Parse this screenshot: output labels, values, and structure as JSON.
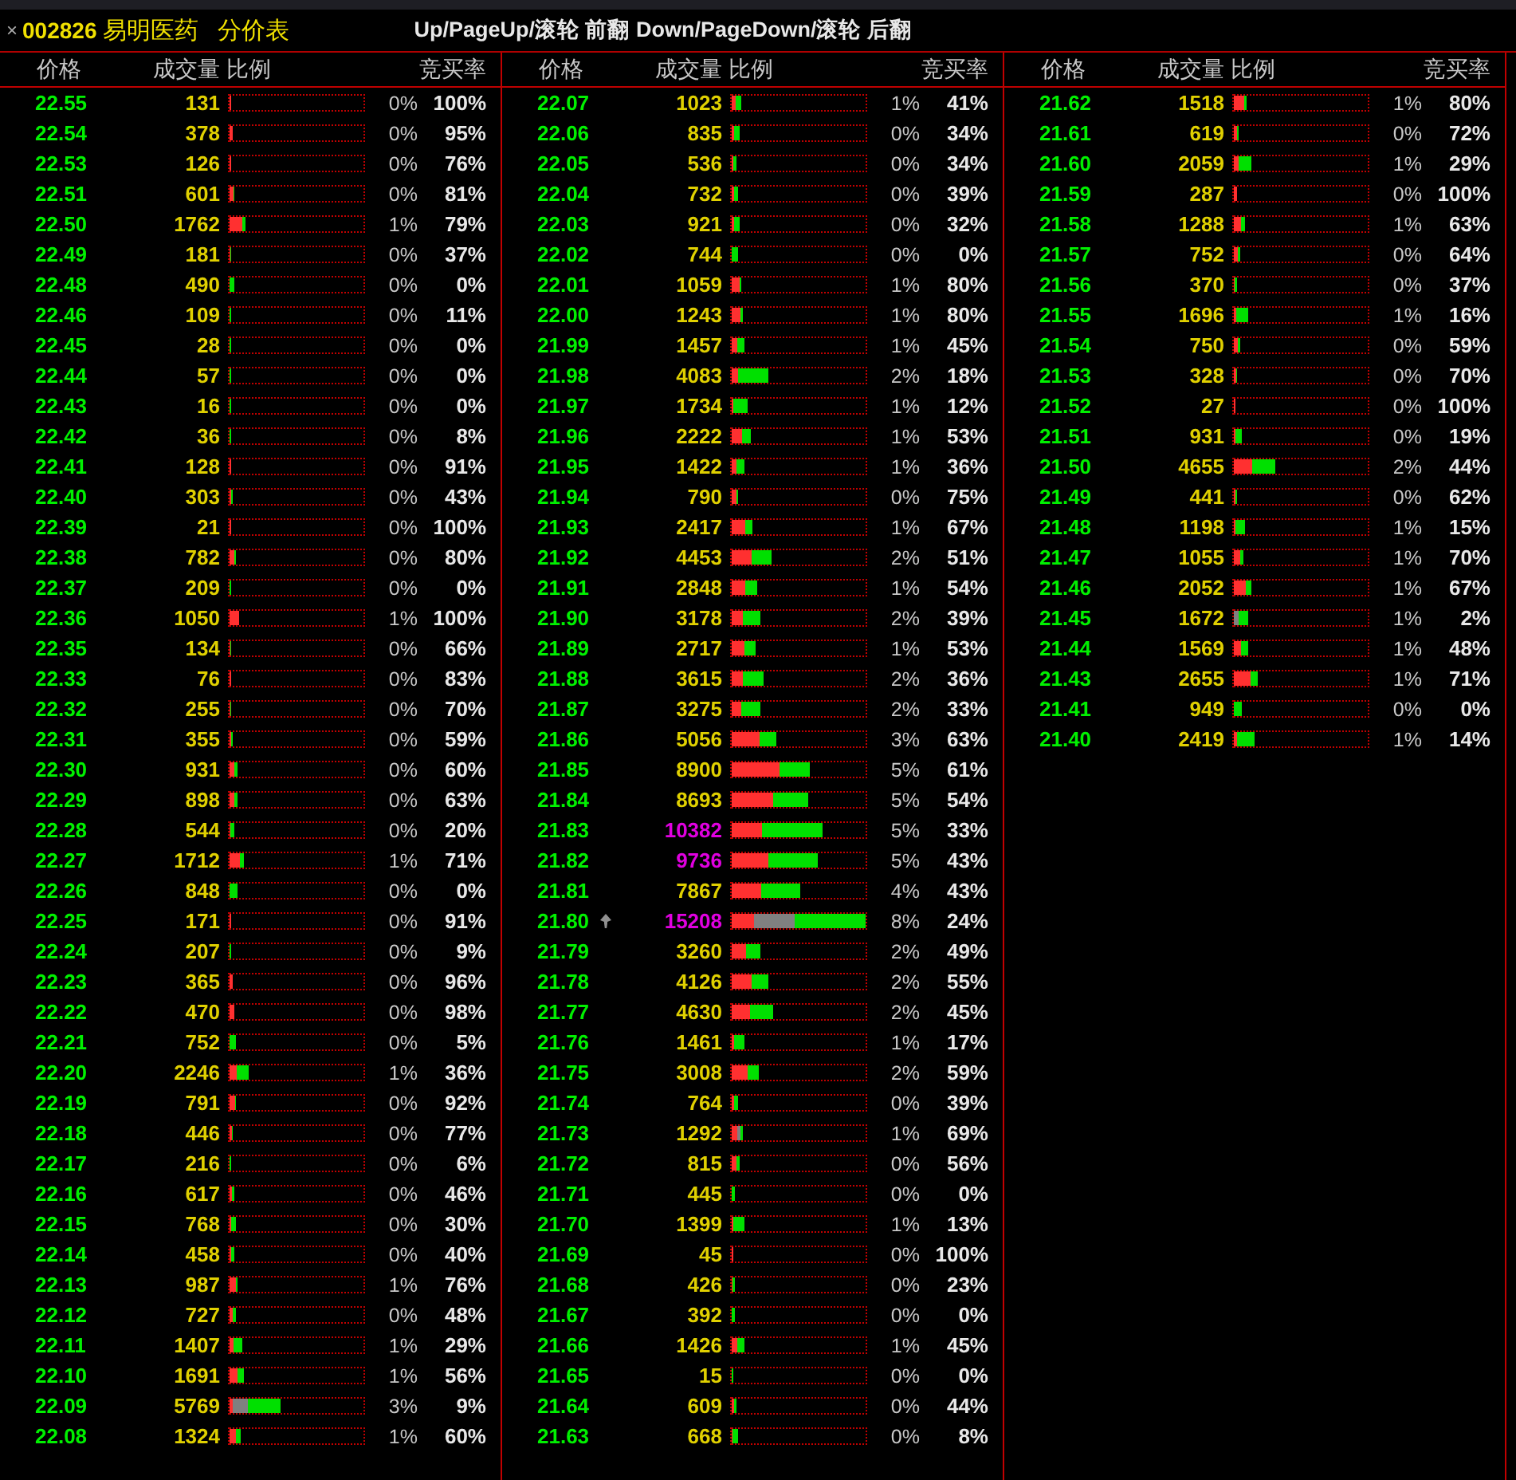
{
  "title": {
    "close": "×",
    "code": "002826",
    "name": "易明医药",
    "view": "分价表"
  },
  "hint": "Up/PageUp/滚轮 前翻 Down/PageDown/滚轮 后翻",
  "panels": [
    {
      "headers": [
        "价格",
        "成交量",
        "比例",
        "竞买率"
      ],
      "rows": [
        {
          "price": "22.55",
          "volume": "131",
          "share": "0%",
          "rate": "100%",
          "level": 0.009,
          "large": false,
          "current": false,
          "neutral": false
        },
        {
          "price": "22.54",
          "volume": "378",
          "share": "0%",
          "rate": "95%",
          "level": 0.025,
          "large": false,
          "current": false,
          "neutral": false
        },
        {
          "price": "22.53",
          "volume": "126",
          "share": "0%",
          "rate": "76%",
          "level": 0.008,
          "large": false,
          "current": false,
          "neutral": false
        },
        {
          "price": "22.51",
          "volume": "601",
          "share": "0%",
          "rate": "81%",
          "level": 0.04,
          "large": false,
          "current": false,
          "neutral": false
        },
        {
          "price": "22.50",
          "volume": "1762",
          "share": "1%",
          "rate": "79%",
          "level": 0.116,
          "large": false,
          "current": false,
          "neutral": false
        },
        {
          "price": "22.49",
          "volume": "181",
          "share": "0%",
          "rate": "37%",
          "level": 0.012,
          "large": false,
          "current": false,
          "neutral": false
        },
        {
          "price": "22.48",
          "volume": "490",
          "share": "0%",
          "rate": "0%",
          "level": 0.032,
          "large": false,
          "current": false,
          "neutral": false
        },
        {
          "price": "22.46",
          "volume": "109",
          "share": "0%",
          "rate": "11%",
          "level": 0.007,
          "large": false,
          "current": false,
          "neutral": false
        },
        {
          "price": "22.45",
          "volume": "28",
          "share": "0%",
          "rate": "0%",
          "level": 0.002,
          "large": false,
          "current": false,
          "neutral": false
        },
        {
          "price": "22.44",
          "volume": "57",
          "share": "0%",
          "rate": "0%",
          "level": 0.004,
          "large": false,
          "current": false,
          "neutral": false
        },
        {
          "price": "22.43",
          "volume": "16",
          "share": "0%",
          "rate": "0%",
          "level": 0.001,
          "large": false,
          "current": false,
          "neutral": false
        },
        {
          "price": "22.42",
          "volume": "36",
          "share": "0%",
          "rate": "8%",
          "level": 0.002,
          "large": false,
          "current": false,
          "neutral": false
        },
        {
          "price": "22.41",
          "volume": "128",
          "share": "0%",
          "rate": "91%",
          "level": 0.008,
          "large": false,
          "current": false,
          "neutral": false
        },
        {
          "price": "22.40",
          "volume": "303",
          "share": "0%",
          "rate": "43%",
          "level": 0.02,
          "large": false,
          "current": false,
          "neutral": false
        },
        {
          "price": "22.39",
          "volume": "21",
          "share": "0%",
          "rate": "100%",
          "level": 0.001,
          "large": false,
          "current": false,
          "neutral": false
        },
        {
          "price": "22.38",
          "volume": "782",
          "share": "0%",
          "rate": "80%",
          "level": 0.051,
          "large": false,
          "current": false,
          "neutral": false
        },
        {
          "price": "22.37",
          "volume": "209",
          "share": "0%",
          "rate": "0%",
          "level": 0.014,
          "large": false,
          "current": false,
          "neutral": false
        },
        {
          "price": "22.36",
          "volume": "1050",
          "share": "1%",
          "rate": "100%",
          "level": 0.069,
          "large": false,
          "current": false,
          "neutral": false
        },
        {
          "price": "22.35",
          "volume": "134",
          "share": "0%",
          "rate": "66%",
          "level": 0.009,
          "large": false,
          "current": false,
          "neutral": false
        },
        {
          "price": "22.33",
          "volume": "76",
          "share": "0%",
          "rate": "83%",
          "level": 0.005,
          "large": false,
          "current": false,
          "neutral": false
        },
        {
          "price": "22.32",
          "volume": "255",
          "share": "0%",
          "rate": "70%",
          "level": 0.017,
          "large": false,
          "current": false,
          "neutral": false
        },
        {
          "price": "22.31",
          "volume": "355",
          "share": "0%",
          "rate": "59%",
          "level": 0.023,
          "large": false,
          "current": false,
          "neutral": false
        },
        {
          "price": "22.30",
          "volume": "931",
          "share": "0%",
          "rate": "60%",
          "level": 0.061,
          "large": false,
          "current": false,
          "neutral": false
        },
        {
          "price": "22.29",
          "volume": "898",
          "share": "0%",
          "rate": "63%",
          "level": 0.059,
          "large": false,
          "current": false,
          "neutral": false
        },
        {
          "price": "22.28",
          "volume": "544",
          "share": "0%",
          "rate": "20%",
          "level": 0.036,
          "large": false,
          "current": false,
          "neutral": false
        },
        {
          "price": "22.27",
          "volume": "1712",
          "share": "1%",
          "rate": "71%",
          "level": 0.113,
          "large": false,
          "current": false,
          "neutral": false
        },
        {
          "price": "22.26",
          "volume": "848",
          "share": "0%",
          "rate": "0%",
          "level": 0.056,
          "large": false,
          "current": false,
          "neutral": false
        },
        {
          "price": "22.25",
          "volume": "171",
          "share": "0%",
          "rate": "91%",
          "level": 0.011,
          "large": false,
          "current": false,
          "neutral": false
        },
        {
          "price": "22.24",
          "volume": "207",
          "share": "0%",
          "rate": "9%",
          "level": 0.014,
          "large": false,
          "current": false,
          "neutral": false
        },
        {
          "price": "22.23",
          "volume": "365",
          "share": "0%",
          "rate": "96%",
          "level": 0.024,
          "large": false,
          "current": false,
          "neutral": false
        },
        {
          "price": "22.22",
          "volume": "470",
          "share": "0%",
          "rate": "98%",
          "level": 0.031,
          "large": false,
          "current": false,
          "neutral": false
        },
        {
          "price": "22.21",
          "volume": "752",
          "share": "0%",
          "rate": "5%",
          "level": 0.049,
          "large": false,
          "current": false,
          "neutral": false
        },
        {
          "price": "22.20",
          "volume": "2246",
          "share": "1%",
          "rate": "36%",
          "level": 0.148,
          "large": false,
          "current": false,
          "neutral": false
        },
        {
          "price": "22.19",
          "volume": "791",
          "share": "0%",
          "rate": "92%",
          "level": 0.052,
          "large": false,
          "current": false,
          "neutral": false
        },
        {
          "price": "22.18",
          "volume": "446",
          "share": "0%",
          "rate": "77%",
          "level": 0.029,
          "large": false,
          "current": false,
          "neutral": false
        },
        {
          "price": "22.17",
          "volume": "216",
          "share": "0%",
          "rate": "6%",
          "level": 0.014,
          "large": false,
          "current": false,
          "neutral": false
        },
        {
          "price": "22.16",
          "volume": "617",
          "share": "0%",
          "rate": "46%",
          "level": 0.041,
          "large": false,
          "current": false,
          "neutral": false
        },
        {
          "price": "22.15",
          "volume": "768",
          "share": "0%",
          "rate": "30%",
          "level": 0.05,
          "large": false,
          "current": false,
          "neutral": false
        },
        {
          "price": "22.14",
          "volume": "458",
          "share": "0%",
          "rate": "40%",
          "level": 0.03,
          "large": false,
          "current": false,
          "neutral": false
        },
        {
          "price": "22.13",
          "volume": "987",
          "share": "1%",
          "rate": "76%",
          "level": 0.065,
          "large": false,
          "current": false,
          "neutral": false
        },
        {
          "price": "22.12",
          "volume": "727",
          "share": "0%",
          "rate": "48%",
          "level": 0.048,
          "large": false,
          "current": false,
          "neutral": false
        },
        {
          "price": "22.11",
          "volume": "1407",
          "share": "1%",
          "rate": "29%",
          "level": 0.093,
          "large": false,
          "current": false,
          "neutral": false
        },
        {
          "price": "22.10",
          "volume": "1691",
          "share": "1%",
          "rate": "56%",
          "level": 0.111,
          "large": false,
          "current": false,
          "neutral": false
        },
        {
          "price": "22.09",
          "volume": "5769",
          "share": "3%",
          "rate": "9%",
          "level": 0.379,
          "large": false,
          "current": false,
          "neutral": true
        },
        {
          "price": "22.08",
          "volume": "1324",
          "share": "1%",
          "rate": "60%",
          "level": 0.087,
          "large": false,
          "current": false,
          "neutral": false
        }
      ]
    },
    {
      "headers": [
        "价格",
        "成交量",
        "比例",
        "竞买率"
      ],
      "rows": [
        {
          "price": "22.07",
          "volume": "1023",
          "share": "1%",
          "rate": "41%",
          "level": 0.067,
          "large": false,
          "current": false,
          "neutral": false
        },
        {
          "price": "22.06",
          "volume": "835",
          "share": "0%",
          "rate": "34%",
          "level": 0.055,
          "large": false,
          "current": false,
          "neutral": false
        },
        {
          "price": "22.05",
          "volume": "536",
          "share": "0%",
          "rate": "34%",
          "level": 0.035,
          "large": false,
          "current": false,
          "neutral": false
        },
        {
          "price": "22.04",
          "volume": "732",
          "share": "0%",
          "rate": "39%",
          "level": 0.048,
          "large": false,
          "current": false,
          "neutral": false
        },
        {
          "price": "22.03",
          "volume": "921",
          "share": "0%",
          "rate": "32%",
          "level": 0.061,
          "large": false,
          "current": false,
          "neutral": false
        },
        {
          "price": "22.02",
          "volume": "744",
          "share": "0%",
          "rate": "0%",
          "level": 0.049,
          "large": false,
          "current": false,
          "neutral": false
        },
        {
          "price": "22.01",
          "volume": "1059",
          "share": "1%",
          "rate": "80%",
          "level": 0.07,
          "large": false,
          "current": false,
          "neutral": false
        },
        {
          "price": "22.00",
          "volume": "1243",
          "share": "1%",
          "rate": "80%",
          "level": 0.082,
          "large": false,
          "current": false,
          "neutral": false
        },
        {
          "price": "21.99",
          "volume": "1457",
          "share": "1%",
          "rate": "45%",
          "level": 0.096,
          "large": false,
          "current": false,
          "neutral": false
        },
        {
          "price": "21.98",
          "volume": "4083",
          "share": "2%",
          "rate": "18%",
          "level": 0.268,
          "large": false,
          "current": false,
          "neutral": false
        },
        {
          "price": "21.97",
          "volume": "1734",
          "share": "1%",
          "rate": "12%",
          "level": 0.114,
          "large": false,
          "current": false,
          "neutral": false
        },
        {
          "price": "21.96",
          "volume": "2222",
          "share": "1%",
          "rate": "53%",
          "level": 0.146,
          "large": false,
          "current": false,
          "neutral": false
        },
        {
          "price": "21.95",
          "volume": "1422",
          "share": "1%",
          "rate": "36%",
          "level": 0.094,
          "large": false,
          "current": false,
          "neutral": false
        },
        {
          "price": "21.94",
          "volume": "790",
          "share": "0%",
          "rate": "75%",
          "level": 0.052,
          "large": false,
          "current": false,
          "neutral": false
        },
        {
          "price": "21.93",
          "volume": "2417",
          "share": "1%",
          "rate": "67%",
          "level": 0.159,
          "large": false,
          "current": false,
          "neutral": false
        },
        {
          "price": "21.92",
          "volume": "4453",
          "share": "2%",
          "rate": "51%",
          "level": 0.293,
          "large": false,
          "current": false,
          "neutral": false
        },
        {
          "price": "21.91",
          "volume": "2848",
          "share": "1%",
          "rate": "54%",
          "level": 0.187,
          "large": false,
          "current": false,
          "neutral": false
        },
        {
          "price": "21.90",
          "volume": "3178",
          "share": "2%",
          "rate": "39%",
          "level": 0.209,
          "large": false,
          "current": false,
          "neutral": false
        },
        {
          "price": "21.89",
          "volume": "2717",
          "share": "1%",
          "rate": "53%",
          "level": 0.179,
          "large": false,
          "current": false,
          "neutral": false
        },
        {
          "price": "21.88",
          "volume": "3615",
          "share": "2%",
          "rate": "36%",
          "level": 0.238,
          "large": false,
          "current": false,
          "neutral": false
        },
        {
          "price": "21.87",
          "volume": "3275",
          "share": "2%",
          "rate": "33%",
          "level": 0.215,
          "large": false,
          "current": false,
          "neutral": false
        },
        {
          "price": "21.86",
          "volume": "5056",
          "share": "3%",
          "rate": "63%",
          "level": 0.332,
          "large": false,
          "current": false,
          "neutral": false
        },
        {
          "price": "21.85",
          "volume": "8900",
          "share": "5%",
          "rate": "61%",
          "level": 0.585,
          "large": false,
          "current": false,
          "neutral": false
        },
        {
          "price": "21.84",
          "volume": "8693",
          "share": "5%",
          "rate": "54%",
          "level": 0.572,
          "large": false,
          "current": false,
          "neutral": false
        },
        {
          "price": "21.83",
          "volume": "10382",
          "share": "5%",
          "rate": "33%",
          "level": 0.683,
          "large": true,
          "current": false,
          "neutral": false
        },
        {
          "price": "21.82",
          "volume": "9736",
          "share": "5%",
          "rate": "43%",
          "level": 0.64,
          "large": true,
          "current": false,
          "neutral": false
        },
        {
          "price": "21.81",
          "volume": "7867",
          "share": "4%",
          "rate": "43%",
          "level": 0.517,
          "large": false,
          "current": false,
          "neutral": false
        },
        {
          "price": "21.80",
          "volume": "15208",
          "share": "8%",
          "rate": "24%",
          "level": 1,
          "large": true,
          "current": true,
          "neutral": true
        },
        {
          "price": "21.79",
          "volume": "3260",
          "share": "2%",
          "rate": "49%",
          "level": 0.214,
          "large": false,
          "current": false,
          "neutral": false
        },
        {
          "price": "21.78",
          "volume": "4126",
          "share": "2%",
          "rate": "55%",
          "level": 0.271,
          "large": false,
          "current": false,
          "neutral": false
        },
        {
          "price": "21.77",
          "volume": "4630",
          "share": "2%",
          "rate": "45%",
          "level": 0.304,
          "large": false,
          "current": false,
          "neutral": false
        },
        {
          "price": "21.76",
          "volume": "1461",
          "share": "1%",
          "rate": "17%",
          "level": 0.096,
          "large": false,
          "current": false,
          "neutral": false
        },
        {
          "price": "21.75",
          "volume": "3008",
          "share": "2%",
          "rate": "59%",
          "level": 0.198,
          "large": false,
          "current": false,
          "neutral": false
        },
        {
          "price": "21.74",
          "volume": "764",
          "share": "0%",
          "rate": "39%",
          "level": 0.05,
          "large": false,
          "current": false,
          "neutral": false
        },
        {
          "price": "21.73",
          "volume": "1292",
          "share": "1%",
          "rate": "69%",
          "level": 0.085,
          "large": false,
          "current": false,
          "neutral": true
        },
        {
          "price": "21.72",
          "volume": "815",
          "share": "0%",
          "rate": "56%",
          "level": 0.054,
          "large": false,
          "current": false,
          "neutral": false
        },
        {
          "price": "21.71",
          "volume": "445",
          "share": "0%",
          "rate": "0%",
          "level": 0.029,
          "large": false,
          "current": false,
          "neutral": false
        },
        {
          "price": "21.70",
          "volume": "1399",
          "share": "1%",
          "rate": "13%",
          "level": 0.092,
          "large": false,
          "current": false,
          "neutral": false
        },
        {
          "price": "21.69",
          "volume": "45",
          "share": "0%",
          "rate": "100%",
          "level": 0.003,
          "large": false,
          "current": false,
          "neutral": false
        },
        {
          "price": "21.68",
          "volume": "426",
          "share": "0%",
          "rate": "23%",
          "level": 0.028,
          "large": false,
          "current": false,
          "neutral": false
        },
        {
          "price": "21.67",
          "volume": "392",
          "share": "0%",
          "rate": "0%",
          "level": 0.026,
          "large": false,
          "current": false,
          "neutral": false
        },
        {
          "price": "21.66",
          "volume": "1426",
          "share": "1%",
          "rate": "45%",
          "level": 0.094,
          "large": false,
          "current": false,
          "neutral": false
        },
        {
          "price": "21.65",
          "volume": "15",
          "share": "0%",
          "rate": "0%",
          "level": 0.001,
          "large": false,
          "current": false,
          "neutral": false
        },
        {
          "price": "21.64",
          "volume": "609",
          "share": "0%",
          "rate": "44%",
          "level": 0.04,
          "large": false,
          "current": false,
          "neutral": false
        },
        {
          "price": "21.63",
          "volume": "668",
          "share": "0%",
          "rate": "8%",
          "level": 0.044,
          "large": false,
          "current": false,
          "neutral": false
        }
      ]
    },
    {
      "headers": [
        "价格",
        "成交量",
        "比例",
        "竞买率"
      ],
      "rows": [
        {
          "price": "21.62",
          "volume": "1518",
          "share": "1%",
          "rate": "80%",
          "level": 0.1,
          "large": false,
          "current": false,
          "neutral": false
        },
        {
          "price": "21.61",
          "volume": "619",
          "share": "0%",
          "rate": "72%",
          "level": 0.041,
          "large": false,
          "current": false,
          "neutral": false
        },
        {
          "price": "21.60",
          "volume": "2059",
          "share": "1%",
          "rate": "29%",
          "level": 0.135,
          "large": false,
          "current": false,
          "neutral": false
        },
        {
          "price": "21.59",
          "volume": "287",
          "share": "0%",
          "rate": "100%",
          "level": 0.019,
          "large": false,
          "current": false,
          "neutral": false
        },
        {
          "price": "21.58",
          "volume": "1288",
          "share": "1%",
          "rate": "63%",
          "level": 0.085,
          "large": false,
          "current": false,
          "neutral": false
        },
        {
          "price": "21.57",
          "volume": "752",
          "share": "0%",
          "rate": "64%",
          "level": 0.049,
          "large": false,
          "current": false,
          "neutral": false
        },
        {
          "price": "21.56",
          "volume": "370",
          "share": "0%",
          "rate": "37%",
          "level": 0.024,
          "large": false,
          "current": false,
          "neutral": false
        },
        {
          "price": "21.55",
          "volume": "1696",
          "share": "1%",
          "rate": "16%",
          "level": 0.112,
          "large": false,
          "current": false,
          "neutral": false
        },
        {
          "price": "21.54",
          "volume": "750",
          "share": "0%",
          "rate": "59%",
          "level": 0.049,
          "large": false,
          "current": false,
          "neutral": false
        },
        {
          "price": "21.53",
          "volume": "328",
          "share": "0%",
          "rate": "70%",
          "level": 0.022,
          "large": false,
          "current": false,
          "neutral": false
        },
        {
          "price": "21.52",
          "volume": "27",
          "share": "0%",
          "rate": "100%",
          "level": 0.002,
          "large": false,
          "current": false,
          "neutral": false
        },
        {
          "price": "21.51",
          "volume": "931",
          "share": "0%",
          "rate": "19%",
          "level": 0.061,
          "large": false,
          "current": false,
          "neutral": false
        },
        {
          "price": "21.50",
          "volume": "4655",
          "share": "2%",
          "rate": "44%",
          "level": 0.306,
          "large": false,
          "current": false,
          "neutral": false
        },
        {
          "price": "21.49",
          "volume": "441",
          "share": "0%",
          "rate": "62%",
          "level": 0.029,
          "large": false,
          "current": false,
          "neutral": false
        },
        {
          "price": "21.48",
          "volume": "1198",
          "share": "1%",
          "rate": "15%",
          "level": 0.079,
          "large": false,
          "current": false,
          "neutral": false
        },
        {
          "price": "21.47",
          "volume": "1055",
          "share": "1%",
          "rate": "70%",
          "level": 0.069,
          "large": false,
          "current": false,
          "neutral": false
        },
        {
          "price": "21.46",
          "volume": "2052",
          "share": "1%",
          "rate": "67%",
          "level": 0.135,
          "large": false,
          "current": false,
          "neutral": false
        },
        {
          "price": "21.45",
          "volume": "1672",
          "share": "1%",
          "rate": "2%",
          "level": 0.11,
          "large": false,
          "current": false,
          "neutral": true
        },
        {
          "price": "21.44",
          "volume": "1569",
          "share": "1%",
          "rate": "48%",
          "level": 0.103,
          "large": false,
          "current": false,
          "neutral": false
        },
        {
          "price": "21.43",
          "volume": "2655",
          "share": "1%",
          "rate": "71%",
          "level": 0.175,
          "large": false,
          "current": false,
          "neutral": false
        },
        {
          "price": "21.41",
          "volume": "949",
          "share": "0%",
          "rate": "0%",
          "level": 0.062,
          "large": false,
          "current": false,
          "neutral": false
        },
        {
          "price": "21.40",
          "volume": "2419",
          "share": "1%",
          "rate": "14%",
          "level": 0.159,
          "large": false,
          "current": false,
          "neutral": false
        }
      ]
    }
  ]
}
